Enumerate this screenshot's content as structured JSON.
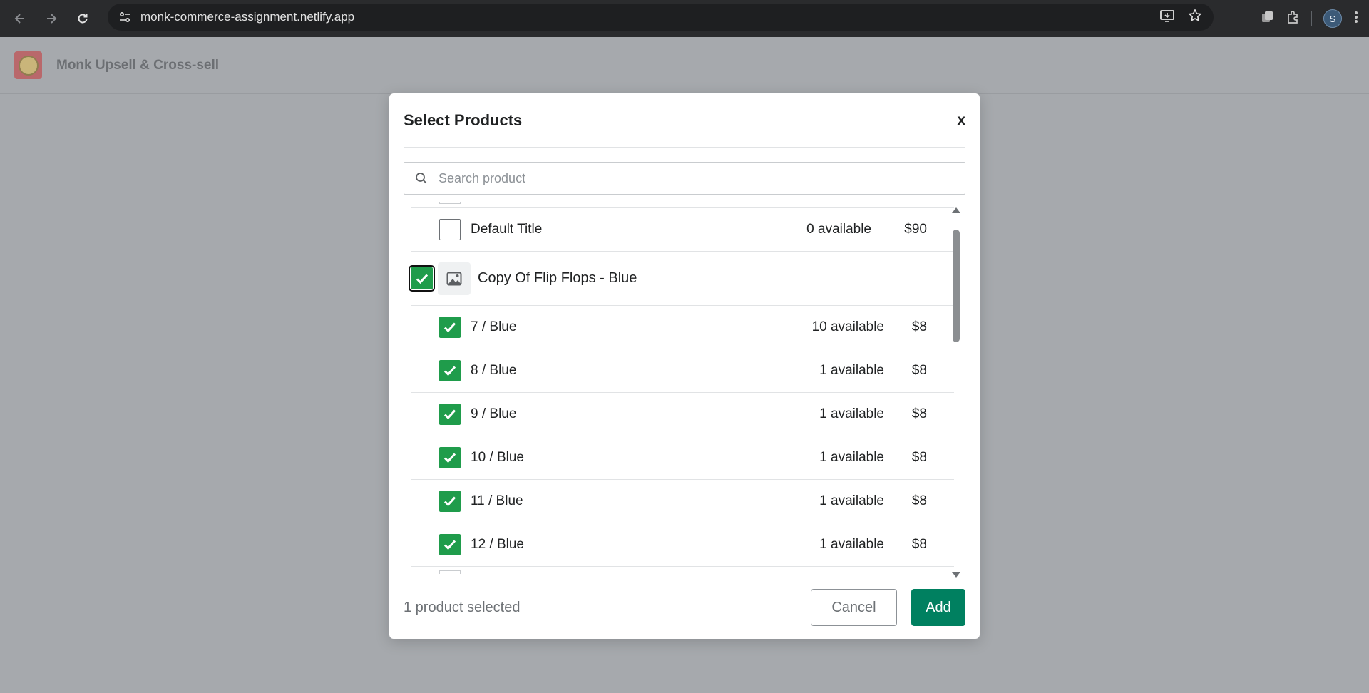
{
  "browser": {
    "url": "monk-commerce-assignment.netlify.app",
    "profile_initial": "S",
    "icons": [
      "back-icon",
      "forward-icon",
      "reload-icon",
      "site-info-icon",
      "install-app-icon",
      "bookmark-star-icon",
      "tab-search-icon",
      "extensions-icon",
      "profile-avatar",
      "menu-kebab-icon"
    ]
  },
  "app": {
    "title": "Monk Upsell & Cross-sell"
  },
  "modal": {
    "title": "Select Products",
    "close_label": "x",
    "search": {
      "placeholder": "Search product",
      "value": ""
    },
    "rows": [
      {
        "type": "variant",
        "name": "Default Title",
        "available": "0 available",
        "price": "$90",
        "checked": false
      },
      {
        "type": "product",
        "name": "Copy Of Flip Flops - Blue",
        "checked": true,
        "focused": true,
        "thumb": "image-placeholder-icon"
      },
      {
        "type": "variant",
        "name": "7 / Blue",
        "available": "10 available",
        "price": "$8",
        "checked": true
      },
      {
        "type": "variant",
        "name": "8 / Blue",
        "available": "1 available",
        "price": "$8",
        "checked": true
      },
      {
        "type": "variant",
        "name": "9 / Blue",
        "available": "1 available",
        "price": "$8",
        "checked": true
      },
      {
        "type": "variant",
        "name": "10 / Blue",
        "available": "1 available",
        "price": "$8",
        "checked": true
      },
      {
        "type": "variant",
        "name": "11 / Blue",
        "available": "1 available",
        "price": "$8",
        "checked": true
      },
      {
        "type": "variant",
        "name": "12 / Blue",
        "available": "1 available",
        "price": "$8",
        "checked": true
      }
    ],
    "footer": {
      "selected_text": "1 product selected",
      "cancel_label": "Cancel",
      "add_label": "Add"
    }
  },
  "colors": {
    "accent_green": "#008060",
    "checkbox_green": "#1f9c4b",
    "overlay": "#a6a9ad"
  }
}
